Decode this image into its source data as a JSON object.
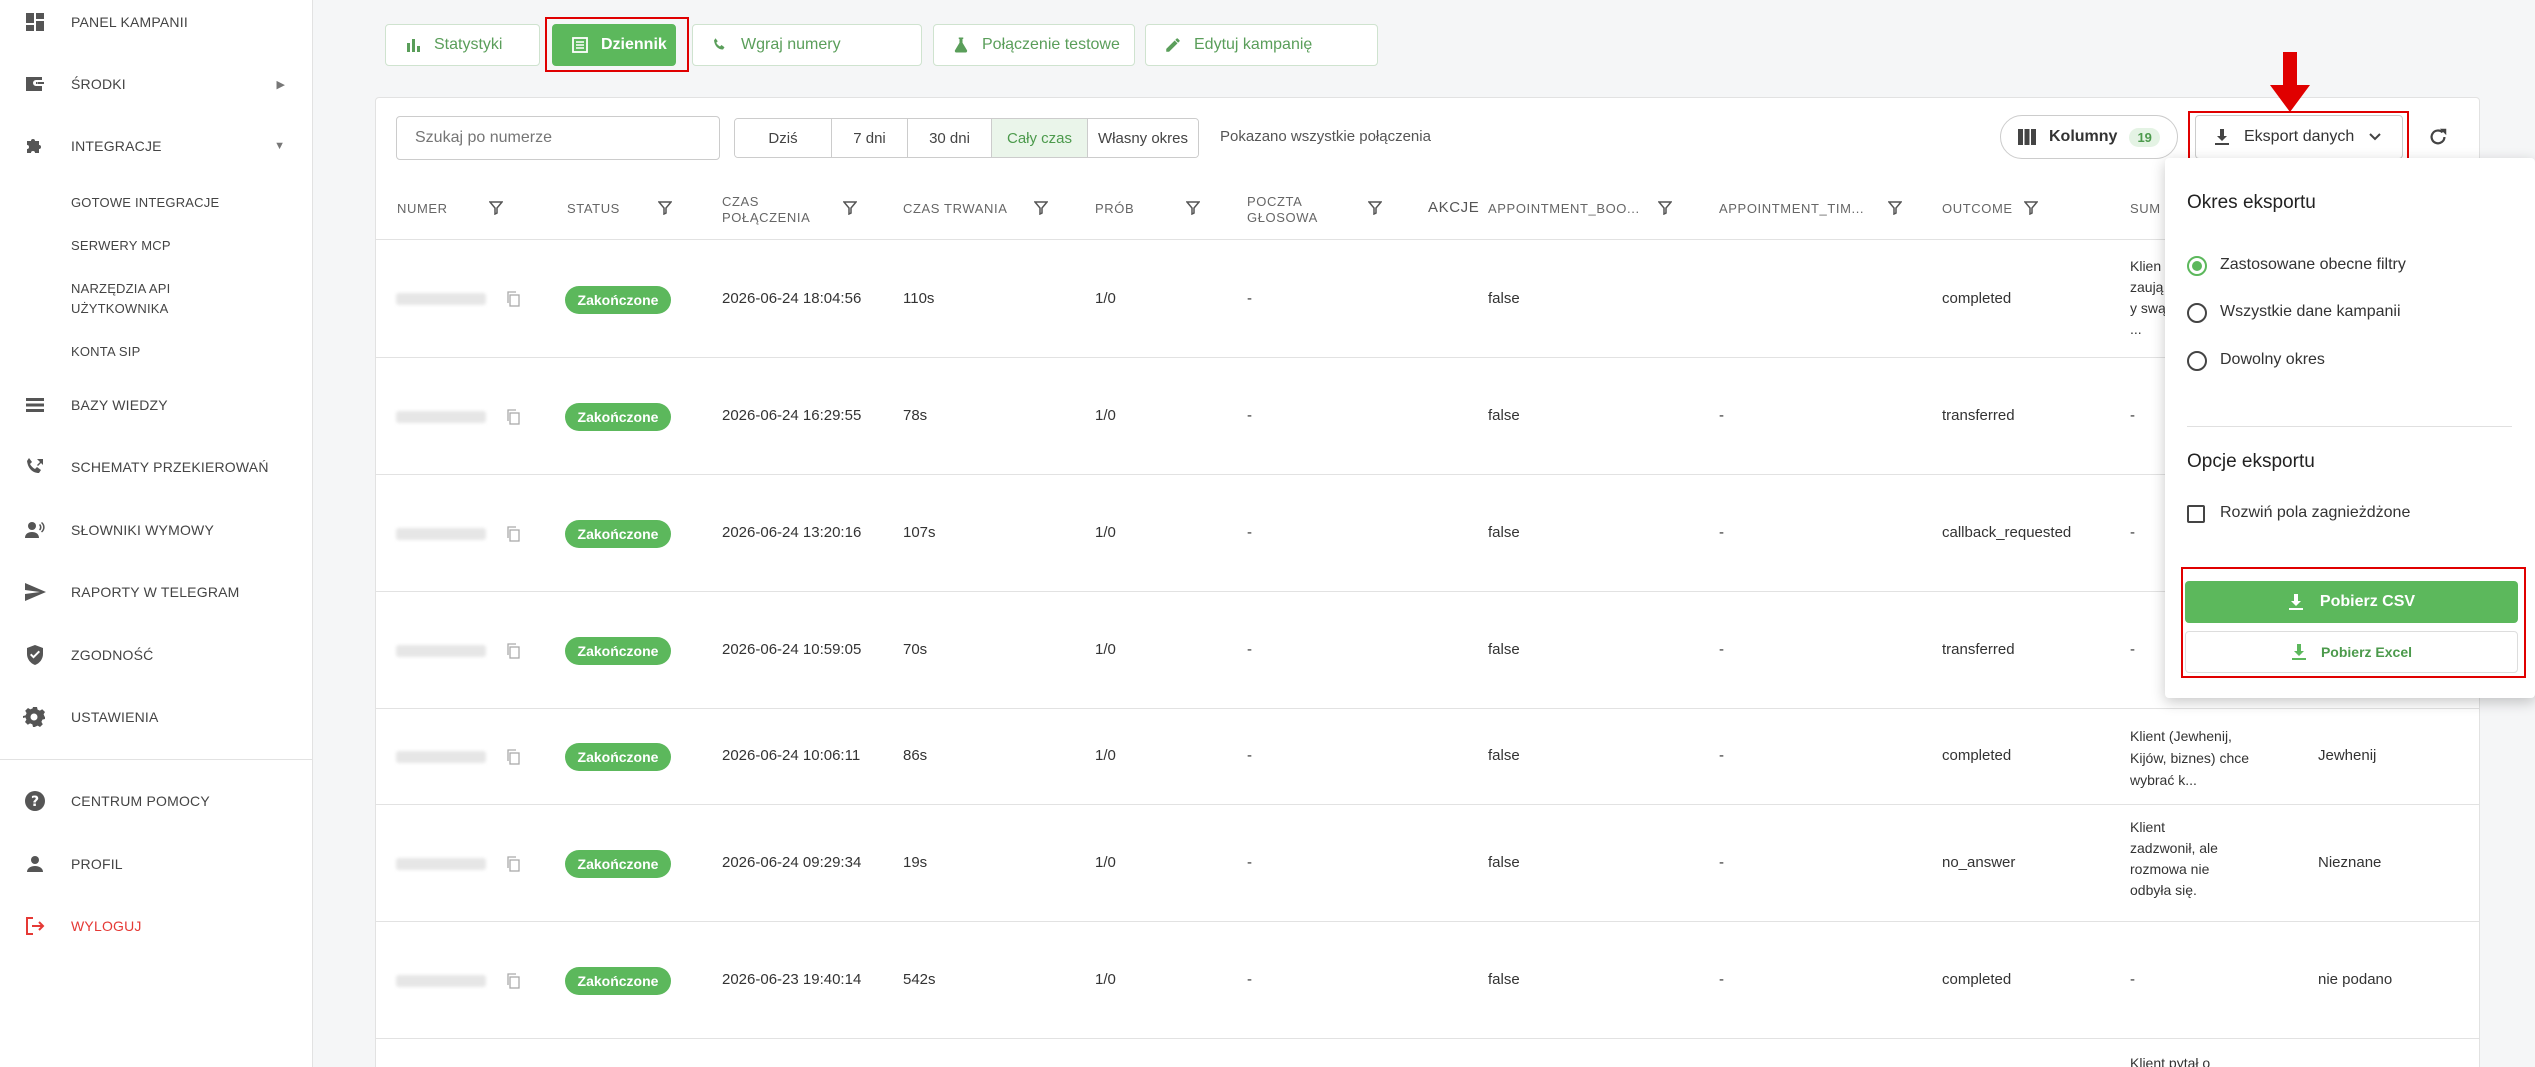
{
  "sidebar": {
    "items": [
      {
        "label": "PANEL KAMPANII",
        "icon": "dashboard-icon"
      },
      {
        "label": "ŚRODKI",
        "icon": "wallet-icon"
      },
      {
        "label": "INTEGRACJE",
        "icon": "puzzle-icon"
      },
      {
        "label": "BAZY WIEDZY",
        "icon": "list-icon"
      },
      {
        "label": "SCHEMATY PRZEKIEROWAŃ",
        "icon": "phone-forward-icon"
      },
      {
        "label": "SŁOWNIKI WYMOWY",
        "icon": "speaker-icon"
      },
      {
        "label": "RAPORTY W TELEGRAM",
        "icon": "send-icon"
      },
      {
        "label": "ZGODNOŚĆ",
        "icon": "shield-icon"
      },
      {
        "label": "USTAWIENIA",
        "icon": "gear-icon"
      },
      {
        "label": "CENTRUM POMOCY",
        "icon": "help-icon"
      },
      {
        "label": "PROFIL",
        "icon": "person-icon"
      },
      {
        "label": "WYLOGUJ",
        "icon": "logout-icon"
      }
    ],
    "subitems": [
      "GOTOWE INTEGRACJE",
      "SERWERY MCP",
      "NARZĘDZIA API",
      "UŻYTKOWNIKA",
      "KONTA SIP"
    ]
  },
  "tabs": [
    "Statystyki",
    "Dziennik",
    "Wgraj numery",
    "Połączenie testowe",
    "Edytuj kampanię"
  ],
  "toolbar": {
    "search_placeholder": "Szukaj po numerze",
    "ranges": [
      "Dziś",
      "7 dni",
      "30 dni",
      "Cały czas",
      "Własny okres"
    ],
    "shown_text": "Pokazano wszystkie połączenia",
    "columns_label": "Kolumny",
    "columns_count": "19",
    "export_label": "Eksport danych"
  },
  "table": {
    "headers": {
      "numer": "NUMER",
      "status": "STATUS",
      "czas1": "CZAS",
      "czas2": "POŁĄCZENIA",
      "trwania": "CZAS TRWANIA",
      "prob": "PRÓB",
      "poczta1": "POCZTA",
      "poczta2": "GŁOSOWA",
      "akcje": "AKCJE",
      "appt_boo": "APPOINTMENT_BOO...",
      "appt_tim": "APPOINTMENT_TIM...",
      "outcome": "OUTCOME",
      "sum": "SUM"
    },
    "rows": [
      {
        "status": "Zakończone",
        "time": "2026-06-24 18:04:56",
        "duration": "110s",
        "tries": "1/0",
        "voicemail": "-",
        "appt_boo": "false",
        "appt_tim": "",
        "outcome": "completed",
        "summary": [
          "Klien",
          "zaują",
          "y swą",
          "..."
        ],
        "extra": ""
      },
      {
        "status": "Zakończone",
        "time": "2026-06-24 16:29:55",
        "duration": "78s",
        "tries": "1/0",
        "voicemail": "-",
        "appt_boo": "false",
        "appt_tim": "-",
        "outcome": "transferred",
        "summary": [
          "-"
        ],
        "extra": ""
      },
      {
        "status": "Zakończone",
        "time": "2026-06-24 13:20:16",
        "duration": "107s",
        "tries": "1/0",
        "voicemail": "-",
        "appt_boo": "false",
        "appt_tim": "-",
        "outcome": "callback_requested",
        "summary": [
          "-"
        ],
        "extra": ""
      },
      {
        "status": "Zakończone",
        "time": "2026-06-24 10:59:05",
        "duration": "70s",
        "tries": "1/0",
        "voicemail": "-",
        "appt_boo": "false",
        "appt_tim": "-",
        "outcome": "transferred",
        "summary": [
          "-"
        ],
        "extra": ""
      },
      {
        "status": "Zakończone",
        "time": "2026-06-24 10:06:11",
        "duration": "86s",
        "tries": "1/0",
        "voicemail": "-",
        "appt_boo": "false",
        "appt_tim": "-",
        "outcome": "completed",
        "summary": [
          "Klient (Jewhenij,",
          "Kijów, biznes) chce",
          "wybrać k..."
        ],
        "extra": "Jewhenij"
      },
      {
        "status": "Zakończone",
        "time": "2026-06-24 09:29:34",
        "duration": "19s",
        "tries": "1/0",
        "voicemail": "-",
        "appt_boo": "false",
        "appt_tim": "-",
        "outcome": "no_answer",
        "summary": [
          "Klient",
          "zadzwonił, ale",
          "rozmowa nie",
          "odbyła się."
        ],
        "extra": "Nieznane"
      },
      {
        "status": "Zakończone",
        "time": "2026-06-23 19:40:14",
        "duration": "542s",
        "tries": "1/0",
        "voicemail": "-",
        "appt_boo": "false",
        "appt_tim": "-",
        "outcome": "completed",
        "summary": [
          "-"
        ],
        "extra": "nie podano"
      },
      {
        "status": "",
        "time": "",
        "duration": "",
        "tries": "",
        "voicemail": "",
        "appt_boo": "",
        "appt_tim": "",
        "outcome": "",
        "summary": [
          "Klient pytał o"
        ],
        "extra": ""
      }
    ]
  },
  "export_menu": {
    "period_title": "Okres eksportu",
    "period_options": [
      "Zastosowane obecne filtry",
      "Wszystkie dane kampanii",
      "Dowolny okres"
    ],
    "selected_index": 0,
    "options_title": "Opcje eksportu",
    "expand_nested": "Rozwiń pola zagnieżdżone",
    "csv_label": "Pobierz CSV",
    "excel_label": "Pobierz Excel"
  },
  "colors": {
    "accent": "#5cb85c",
    "highlight": "#e00000",
    "logout": "#e53935"
  }
}
